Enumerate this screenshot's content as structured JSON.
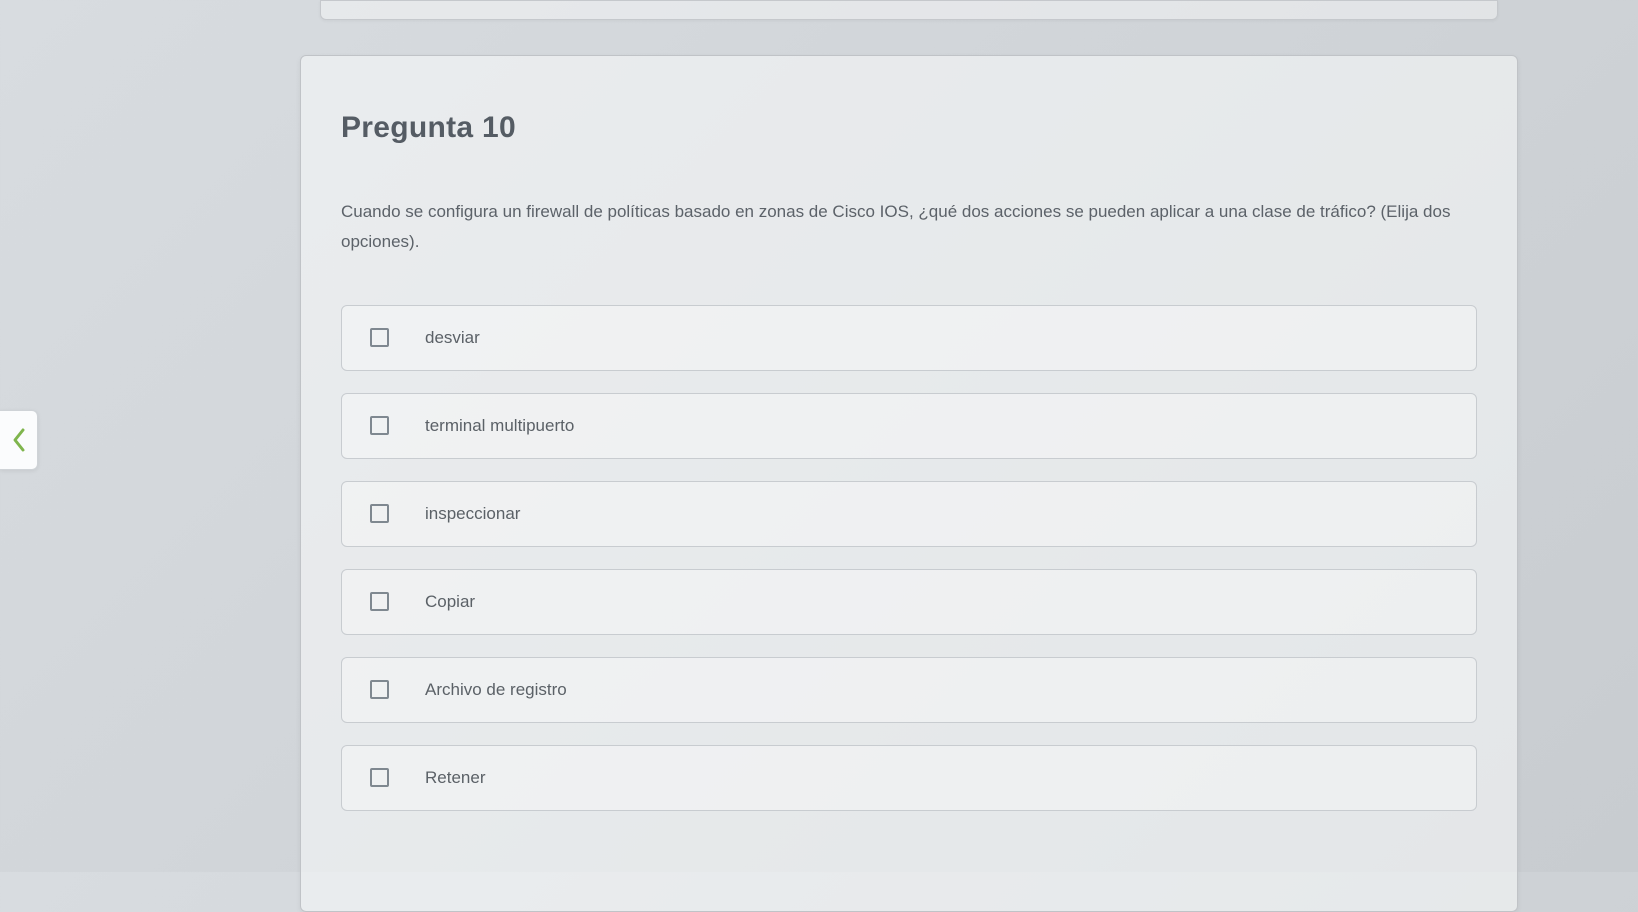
{
  "question": {
    "title": "Pregunta 10",
    "text": "Cuando se configura un firewall de políticas basado en zonas de Cisco IOS, ¿qué dos acciones se pueden aplicar a una clase de tráfico? (Elija dos opciones).",
    "options": [
      {
        "label": "desviar"
      },
      {
        "label": "terminal multipuerto"
      },
      {
        "label": "inspeccionar"
      },
      {
        "label": "Copiar"
      },
      {
        "label": "Archivo de registro"
      },
      {
        "label": "Retener"
      }
    ]
  },
  "nav": {
    "prev_color": "#7fb54d"
  }
}
